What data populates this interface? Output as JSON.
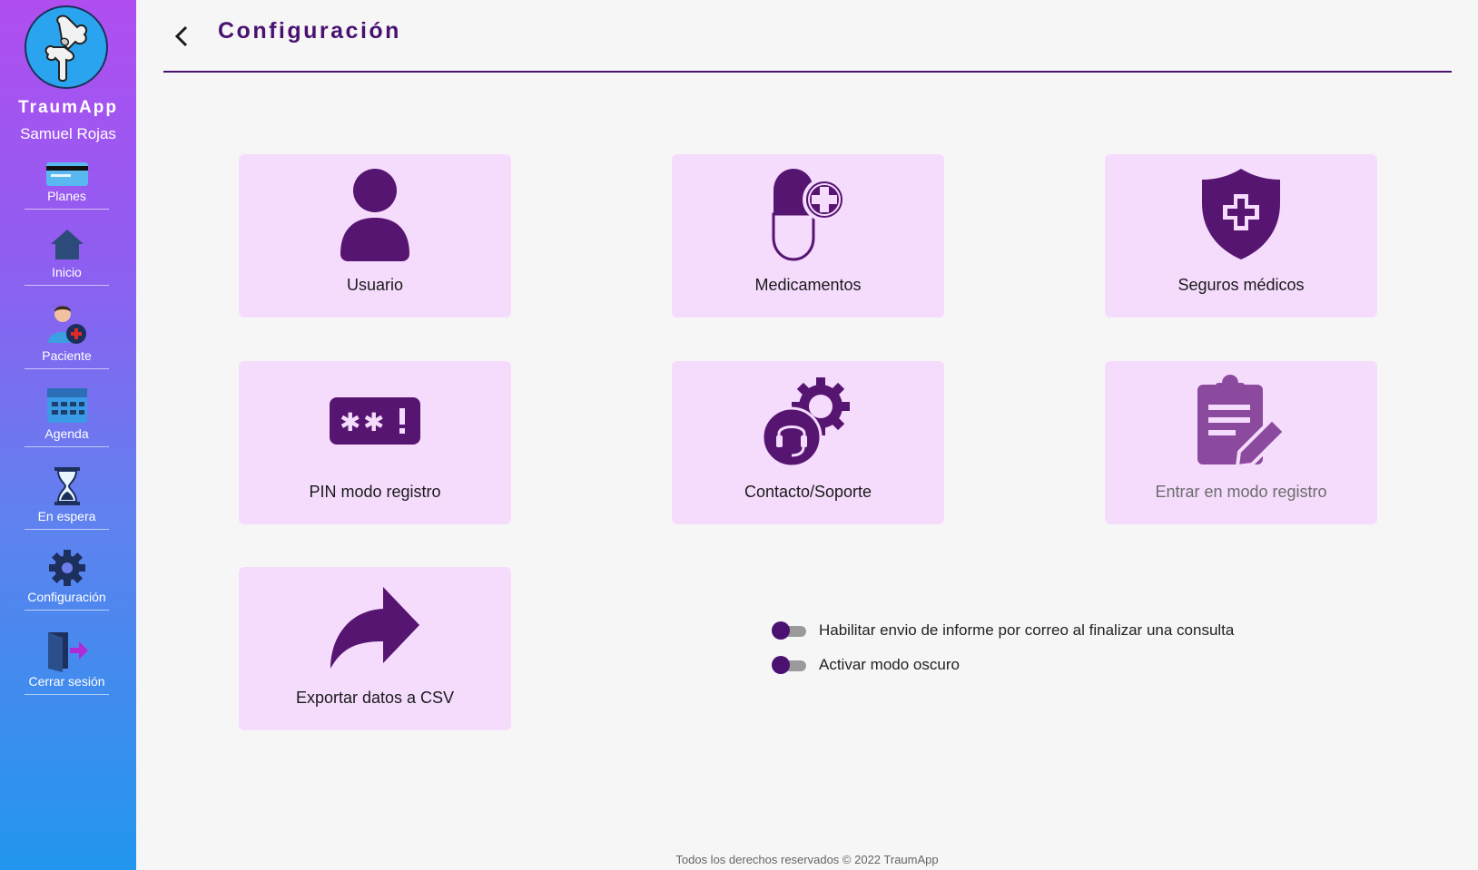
{
  "app": {
    "name": "TraumApp",
    "user": "Samuel Rojas"
  },
  "sidebar": {
    "items": [
      {
        "label": "Planes",
        "icon": "credit-card-icon"
      },
      {
        "label": "Inicio",
        "icon": "home-icon"
      },
      {
        "label": "Paciente",
        "icon": "add-patient-icon"
      },
      {
        "label": "Agenda",
        "icon": "calendar-icon"
      },
      {
        "label": "En espera",
        "icon": "hourglass-icon"
      },
      {
        "label": "Configuración",
        "icon": "gear-icon"
      },
      {
        "label": "Cerrar sesión",
        "icon": "logout-icon"
      }
    ]
  },
  "header": {
    "title": "Configuración",
    "back_icon": "chevron-left-icon"
  },
  "cards": [
    {
      "label": "Usuario",
      "icon": "user-icon"
    },
    {
      "label": "Medicamentos",
      "icon": "capsule-plus-icon"
    },
    {
      "label": "Seguros médicos",
      "icon": "shield-plus-icon"
    },
    {
      "label": "PIN modo registro",
      "icon": "password-pin-icon"
    },
    {
      "label": "Contacto/Soporte",
      "icon": "support-gear-icon"
    },
    {
      "label": "Entrar en modo registro",
      "icon": "clipboard-edit-icon",
      "disabled": true
    },
    {
      "label": "Exportar datos a CSV",
      "icon": "share-arrow-icon"
    }
  ],
  "settings": {
    "email_report": {
      "label": "Habilitar envio de informe por correo al finalizar una consulta",
      "enabled": false
    },
    "dark_mode": {
      "label": "Activar modo oscuro",
      "enabled": false
    }
  },
  "footer": {
    "text": "Todos los derechos reservados © 2022 TraumApp"
  },
  "colors": {
    "accent": "#4a1170",
    "card_bg": "#f5dcfd",
    "sidebar_top": "#b04ef0",
    "sidebar_bottom": "#2196ee"
  }
}
